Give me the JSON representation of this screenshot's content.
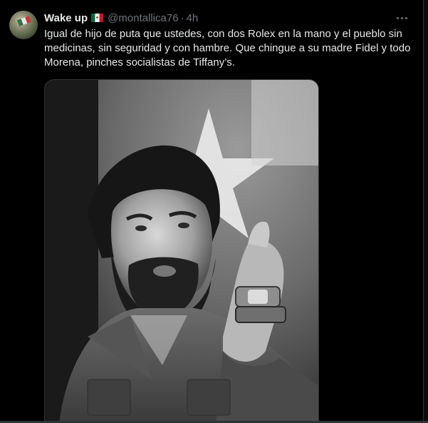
{
  "tweet": {
    "author_name": "Wake up",
    "author_flag": "flag-mexico-icon",
    "handle": "@montallica76",
    "separator": "·",
    "time": "4h",
    "text": "Igual de hijo de puta que ustedes, con dos Rolex en la mano y el pueblo sin medicinas, sin seguridad y con hambre. Que chingue a su madre Fidel y todo Morena, pinches socialistas de Tiffany’s.",
    "media": {
      "description_icon": "photo",
      "style": "black-and-white"
    }
  },
  "colors": {
    "background": "#000000",
    "text_primary": "#e7e9ea",
    "text_secondary": "#71767b",
    "border": "#2f3336"
  }
}
